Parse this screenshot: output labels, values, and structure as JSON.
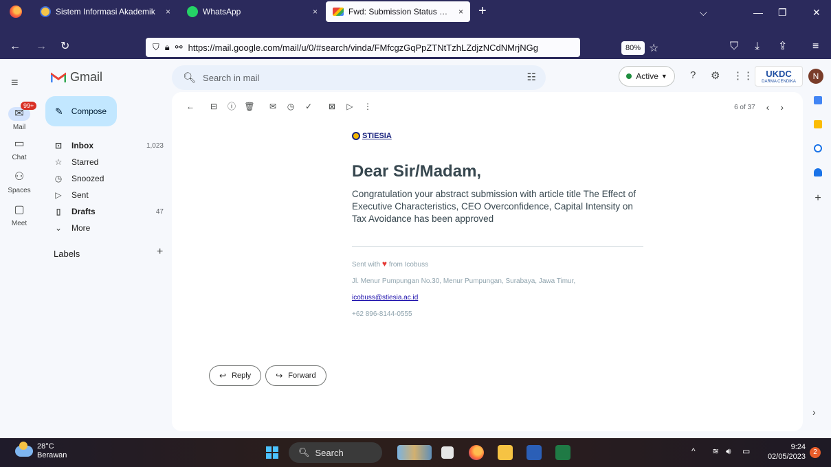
{
  "browser": {
    "tabs": [
      {
        "title": "Sistem Informasi Akademik",
        "close": "×"
      },
      {
        "title": "WhatsApp",
        "close": "×"
      },
      {
        "title": "Fwd: Submission Status Mail - ",
        "close": "×"
      }
    ],
    "new_tab": "+",
    "url": "https://mail.google.com/mail/u/0/#search/vinda/FMfcgzGqPpZTNtTzhLZdjzNCdNMrjNGg",
    "zoom": "80%"
  },
  "gmail": {
    "app_name": "Gmail",
    "search_placeholder": "Search in mail",
    "status": "Active",
    "brand_text": "UKDC",
    "brand_subtext": "DARMA CENDIKA",
    "avatar_initial": "N",
    "rail": {
      "mail": "Mail",
      "mail_badge": "99+",
      "chat": "Chat",
      "spaces": "Spaces",
      "meet": "Meet"
    },
    "compose": "Compose",
    "folders": [
      {
        "label": "Inbox",
        "count": "1,023",
        "bold": true
      },
      {
        "label": "Starred",
        "count": ""
      },
      {
        "label": "Snoozed",
        "count": ""
      },
      {
        "label": "Sent",
        "count": ""
      },
      {
        "label": "Drafts",
        "count": "47",
        "bold": true
      },
      {
        "label": "More",
        "count": ""
      }
    ],
    "labels_heading": "Labels",
    "pager": "6 of 37"
  },
  "email": {
    "logo_text": "STIESIA",
    "greeting": "Dear Sir/Madam,",
    "body": "Congratulation your abstract submission with article title The Effect of Executive Characteristics, CEO Overconfidence, Capital Intensity on Tax Avoidance has been approved",
    "sent_with_prefix": "Sent with",
    "sent_with_suffix": "from Icobuss",
    "address": "Jl. Menur Pumpungan No.30, Menur Pumpungan, Surabaya, Jawa Timur,",
    "email_link": "icobuss@stiesia.ac.id",
    "phone": "+62 896-8144-0555",
    "reply": "Reply",
    "forward": "Forward"
  },
  "taskbar": {
    "temperature": "28°C",
    "weather": "Berawan",
    "search": "Search",
    "time": "9:24",
    "date": "02/05/2023",
    "notifications": "2"
  }
}
